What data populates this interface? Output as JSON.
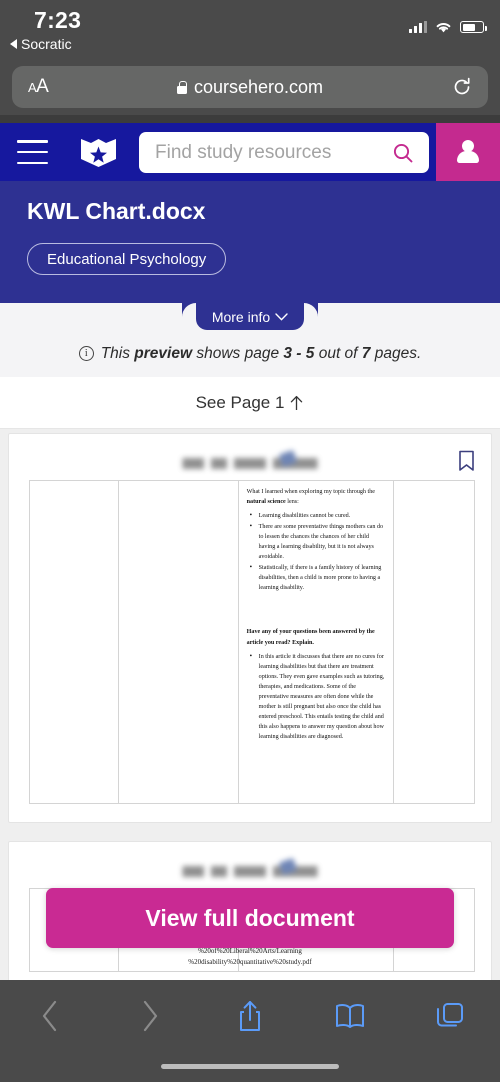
{
  "status_bar": {
    "time": "7:23",
    "back_app_label": "Socratic",
    "back_icon": "triangle-left-icon",
    "signal_icon": "cellular-signal-icon",
    "wifi_icon": "wifi-icon",
    "battery_icon": "battery-icon",
    "battery_level_pct": 58
  },
  "browser": {
    "text_size_label": "A",
    "text_size_label_big": "A",
    "lock_icon": "lock-icon",
    "url": "coursehero.com",
    "reload_icon": "reload-icon",
    "toolbar": {
      "back_icon": "chevron-left-icon",
      "forward_icon": "chevron-right-icon",
      "share_icon": "share-icon",
      "bookmarks_icon": "book-icon",
      "tabs_icon": "tabs-icon"
    }
  },
  "site_nav": {
    "menu_icon": "hamburger-menu-icon",
    "logo_icon": "coursehero-shield-star-logo",
    "search_placeholder": "Find study resources",
    "search_value": "",
    "search_icon": "search-icon",
    "account_icon": "user-avatar-icon"
  },
  "document_header": {
    "title": "KWL Chart.docx",
    "course_tag": "Educational Psychology",
    "more_info_label": "More info",
    "more_info_icon": "chevron-down-icon"
  },
  "preview_notice": {
    "info_icon": "info-icon",
    "prefix": "This ",
    "bold_1": "preview",
    "mid_1": " shows page ",
    "bold_2": "3 - 5",
    "mid_2": " out of ",
    "bold_3": "7",
    "suffix": " pages."
  },
  "see_page": {
    "label": "See Page 1",
    "icon": "arrow-up-icon"
  },
  "preview_pages": {
    "bookmark_icon": "bookmark-icon",
    "page_1": {
      "section_1": {
        "intro_plain": "What I learned when exploring my topic through the ",
        "intro_bold": "natural science",
        "intro_tail": " lens:",
        "bullets": [
          "Learning disabilities cannot be cured.",
          "There are some preventative things mothers can do to lessen the chances the chances of her child having a learning disability, but it is not always avoidable.",
          "Statistically, if there is a family history of learning disabilities, then a child is more prone to having a learning disability."
        ]
      },
      "section_2": {
        "heading": "Have any of your questions been answered by the article you read? Explain.",
        "bullets": [
          "In this article it discusses that there are no cures for learning disabilities but that there are treatment options. They even gave examples such as tutoring, therapies, and medications. Some of the preventative measures are often done while the mother is still pregnant but also once the child has entered preschool. This entails testing the child and this also happens to answer my question about how learning disabilities are diagnosed."
        ]
      }
    },
    "page_2": {
      "url_fragment_line_1": "%20of%20Liberal%20Arts/Learning",
      "url_fragment_line_2": "%20disability%20quantitative%20study.pdf"
    }
  },
  "cta": {
    "label": "View full document"
  },
  "colors": {
    "nav_navy": "#16189e",
    "header_navy": "#2e3192",
    "magenta": "#c92a93",
    "chrome_gray": "#4a4a4a",
    "page_gray": "#efefef"
  }
}
